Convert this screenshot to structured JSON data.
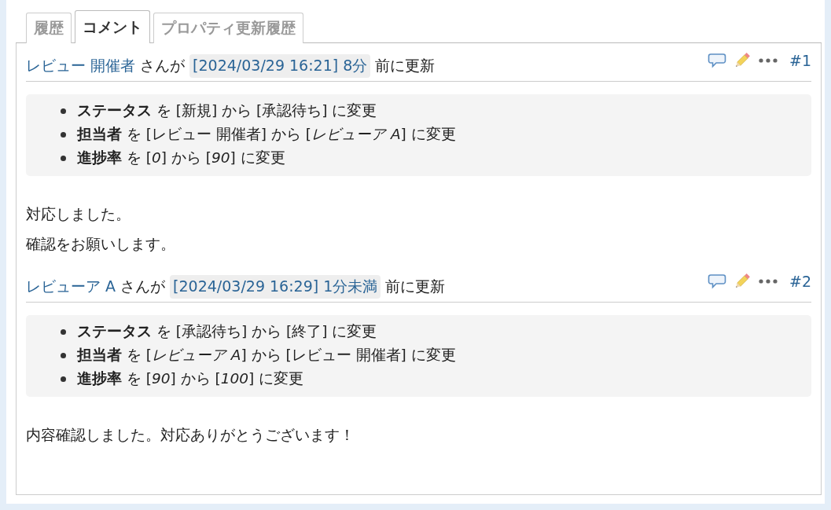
{
  "tabs": [
    {
      "label": "履歴",
      "selected": false
    },
    {
      "label": "コメント",
      "selected": true
    },
    {
      "label": "プロパティ更新履歴",
      "selected": false
    }
  ],
  "comments": [
    {
      "author": "レビュー 開催者",
      "by": "さんが",
      "timestamp": "[2024/03/29 16:21] 8分",
      "updated": "前に更新",
      "number": "#1",
      "changes": [
        "**ステータス** を [新規] から [承認待ち] に変更",
        "**担当者** を [レビュー 開催者] から [*レビューア A*] に変更",
        "**進捗率** を [*0*] から [*90*] に変更"
      ],
      "notes": [
        "対応しました。",
        "確認をお願いします。"
      ]
    },
    {
      "author": "レビューア A",
      "by": "さんが",
      "timestamp": "[2024/03/29 16:29] 1分未満",
      "updated": "前に更新",
      "number": "#2",
      "changes": [
        "**ステータス** を [承認待ち] から [終了] に変更",
        "**担当者** を [*レビューア A*] から [レビュー 開催者] に変更",
        "**進捗率** を [*90*] から [*100*] に変更"
      ],
      "notes": [
        "内容確認しました。対応ありがとうございます！"
      ]
    }
  ]
}
